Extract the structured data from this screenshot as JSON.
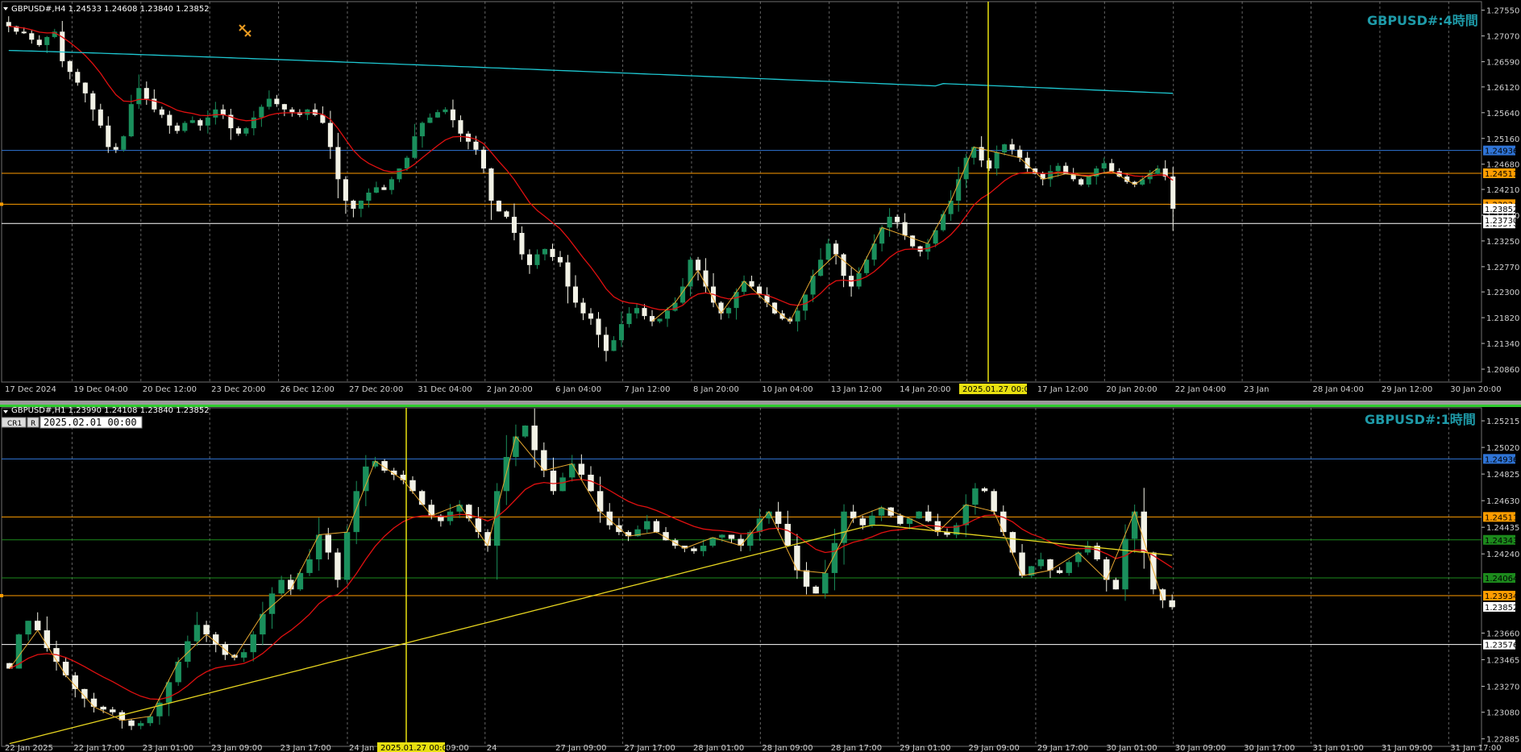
{
  "colors": {
    "background": "#000000",
    "grid": "#b4b4b4",
    "bull": "#1a8f5c",
    "bear": "#f2f2e6",
    "ma_red": "#e01010",
    "ma_cyan": "#1ec8d2",
    "ma_yellow": "#e8d620",
    "zigzag": "#e8a830",
    "line_blue": "#2f74d6",
    "line_orange": "#ff9d00",
    "line_white": "#ffffff",
    "line_green": "#1c8a1c",
    "crosshair": "#e8e010",
    "watermark": "#1e9aa8"
  },
  "chart_data": [
    {
      "type": "candlestick",
      "symbol_header": "GBPUSD#,H4  1.24533 1.24608 1.23840 1.23852",
      "watermark": "GBPUSD#:4時間",
      "ylim": [
        1.2062,
        1.2771
      ],
      "price_ticks": [
        "1.27550",
        "1.27070",
        "1.26590",
        "1.26120",
        "1.25640",
        "1.25160",
        "1.24680",
        "1.24210",
        "1.23730",
        "1.23250",
        "1.22770",
        "1.22300",
        "1.21820",
        "1.21340",
        "1.20860"
      ],
      "price_tick_values": [
        1.2755,
        1.2707,
        1.2659,
        1.2612,
        1.2564,
        1.2516,
        1.2468,
        1.2421,
        1.2373,
        1.2325,
        1.2277,
        1.223,
        1.2182,
        1.2134,
        1.2086
      ],
      "x_labels": [
        "17 Dec 2024",
        "19 Dec 04:00",
        "20 Dec 12:00",
        "23 Dec 20:00",
        "26 Dec 12:00",
        "27 Dec 20:00",
        "31 Dec 04:00",
        "2 Jan 20:00",
        "6 Jan 04:00",
        "7 Jan 12:00",
        "8 Jan 20:00",
        "10 Jan 04:00",
        "13 Jan 12:00",
        "14 Jan 20:00",
        "16 Jan 04:00",
        "17 Jan 12:00",
        "20 Jan 20:00",
        "22 Jan 04:00",
        "23 Jan",
        "28 Jan 04:00",
        "29 Jan 12:00",
        "30 Jan 20:00"
      ],
      "crosshair_time": "2025.01.27 00:00",
      "horizontal_lines": [
        {
          "price": 1.24936,
          "label": "1.24936",
          "color": "#2f74d6"
        },
        {
          "price": 1.24511,
          "label": "1.24511",
          "color": "#ff9d00"
        },
        {
          "price": 1.23934,
          "label": "1.23934",
          "color": "#ff9d00"
        },
        {
          "price": 1.23576,
          "label": "1.23576",
          "color": "#ffffff"
        }
      ],
      "extra_labels": [
        "1.23852",
        "1.23730"
      ],
      "close": [
        1.2725,
        1.2715,
        1.2712,
        1.27,
        1.269,
        1.2705,
        1.2715,
        1.266,
        1.264,
        1.262,
        1.26,
        1.257,
        1.254,
        1.25,
        1.2495,
        1.252,
        1.258,
        1.261,
        1.259,
        1.257,
        1.256,
        1.254,
        1.253,
        1.2545,
        1.255,
        1.254,
        1.2555,
        1.257,
        1.256,
        1.2535,
        1.2525,
        1.2535,
        1.2555,
        1.2575,
        1.259,
        1.258,
        1.257,
        1.2565,
        1.256,
        1.257,
        1.256,
        1.2545,
        1.25,
        1.244,
        1.24,
        1.2385,
        1.24,
        1.2415,
        1.2425,
        1.242,
        1.244,
        1.246,
        1.248,
        1.252,
        1.2545,
        1.2555,
        1.2565,
        1.257,
        1.255,
        1.2525,
        1.251,
        1.2495,
        1.246,
        1.24,
        1.238,
        1.237,
        1.234,
        1.23,
        1.228,
        1.23,
        1.231,
        1.2295,
        1.2285,
        1.224,
        1.221,
        1.219,
        1.218,
        1.215,
        1.212,
        1.214,
        1.217,
        1.219,
        1.22,
        1.2185,
        1.2175,
        1.218,
        1.2195,
        1.221,
        1.224,
        1.229,
        1.227,
        1.224,
        1.221,
        1.219,
        1.22,
        1.223,
        1.225,
        1.224,
        1.2225,
        1.221,
        1.219,
        1.218,
        1.2175,
        1.2195,
        1.2225,
        1.226,
        1.229,
        1.232,
        1.23,
        1.226,
        1.224,
        1.2265,
        1.229,
        1.232,
        1.235,
        1.237,
        1.236,
        1.2335,
        1.2315,
        1.2305,
        1.232,
        1.2345,
        1.2375,
        1.24,
        1.244,
        1.248,
        1.25,
        1.2475,
        1.246,
        1.249,
        1.2505,
        1.2495,
        1.248,
        1.246,
        1.245,
        1.244,
        1.2455,
        1.2465,
        1.245,
        1.244,
        1.243,
        1.2445,
        1.246,
        1.247,
        1.2455,
        1.2445,
        1.2435,
        1.243,
        1.244,
        1.245,
        1.246,
        1.2445,
        1.2385
      ]
    },
    {
      "type": "candlestick",
      "symbol_header": "GBPUSD#,H1  1.23990 1.24108 1.23840 1.23852",
      "watermark": "GBPUSD#:1時間",
      "control_labels": [
        "CR1",
        "R"
      ],
      "datetime_box": "2025.02.01 00:00",
      "ylim": [
        1.2283,
        1.2531
      ],
      "price_ticks": [
        "1.25215",
        "1.25020",
        "1.24825",
        "1.24630",
        "1.24435",
        "1.24240",
        "1.23660",
        "1.23465",
        "1.23270",
        "1.23080",
        "1.22885"
      ],
      "price_tick_values": [
        1.25215,
        1.2502,
        1.24825,
        1.2463,
        1.24435,
        1.2424,
        1.2366,
        1.23465,
        1.2327,
        1.2308,
        1.22885
      ],
      "x_labels": [
        "22 Jan 2025",
        "22 Jan 17:00",
        "23 Jan 01:00",
        "23 Jan 09:00",
        "23 Jan 17:00",
        "24 Jan 01:00",
        "24 Jan 09:00",
        "24",
        "27 Jan 09:00",
        "27 Jan 17:00",
        "28 Jan 01:00",
        "28 Jan 09:00",
        "28 Jan 17:00",
        "29 Jan 01:00",
        "29 Jan 09:00",
        "29 Jan 17:00",
        "30 Jan 01:00",
        "30 Jan 09:00",
        "30 Jan 17:00",
        "31 Jan 01:00",
        "31 Jan 09:00",
        "31 Jan 17:00"
      ],
      "crosshair_time": "2025.01.27 00:00",
      "horizontal_lines": [
        {
          "price": 1.24936,
          "label": "1.24936",
          "color": "#2f74d6"
        },
        {
          "price": 1.24511,
          "label": "1.24511",
          "color": "#ff9d00"
        },
        {
          "price": 1.24343,
          "label": "1.24343",
          "color": "#1c8a1c"
        },
        {
          "price": 1.24064,
          "label": "1.24064",
          "color": "#1c8a1c"
        },
        {
          "price": 1.23934,
          "label": "1.23934",
          "color": "#ff9d00"
        },
        {
          "price": 1.23576,
          "label": "1.23576",
          "color": "#ffffff"
        }
      ],
      "extra_labels": [
        "1.23852"
      ],
      "close": [
        1.234,
        1.2365,
        1.2375,
        1.2368,
        1.2355,
        1.2345,
        1.2335,
        1.2325,
        1.2318,
        1.2312,
        1.231,
        1.2308,
        1.2302,
        1.2298,
        1.23,
        1.2305,
        1.2315,
        1.233,
        1.2345,
        1.236,
        1.2372,
        1.2365,
        1.2358,
        1.235,
        1.2348,
        1.2352,
        1.2365,
        1.238,
        1.2395,
        1.2405,
        1.2398,
        1.241,
        1.242,
        1.2438,
        1.2425,
        1.2405,
        1.244,
        1.247,
        1.2488,
        1.2492,
        1.2485,
        1.2482,
        1.2478,
        1.247,
        1.246,
        1.2452,
        1.2448,
        1.2455,
        1.246,
        1.245,
        1.244,
        1.243,
        1.247,
        1.2495,
        1.251,
        1.2518,
        1.25,
        1.2485,
        1.247,
        1.248,
        1.249,
        1.2482,
        1.247,
        1.2455,
        1.2445,
        1.244,
        1.2437,
        1.2442,
        1.2448,
        1.244,
        1.2434,
        1.243,
        1.2428,
        1.2426,
        1.243,
        1.2436,
        1.2438,
        1.2435,
        1.243,
        1.244,
        1.245,
        1.2455,
        1.2446,
        1.243,
        1.2412,
        1.24,
        1.2395,
        1.241,
        1.2432,
        1.2455,
        1.245,
        1.2445,
        1.2452,
        1.2458,
        1.2452,
        1.2446,
        1.245,
        1.2455,
        1.2448,
        1.244,
        1.2438,
        1.2445,
        1.246,
        1.2472,
        1.247,
        1.2455,
        1.244,
        1.2425,
        1.2408,
        1.2415,
        1.242,
        1.2412,
        1.241,
        1.2418,
        1.2425,
        1.243,
        1.242,
        1.2405,
        1.2398,
        1.2435,
        1.2455,
        1.2425,
        1.2398,
        1.239,
        1.2385
      ]
    }
  ]
}
